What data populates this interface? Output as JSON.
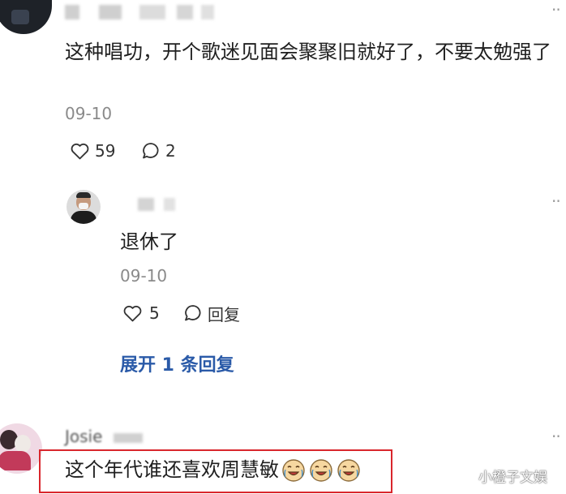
{
  "comment1": {
    "text": "这种唱功，开个歌迷见面会聚聚旧就好了，不要太勉强了",
    "date": "09-10",
    "likes": "59",
    "replies": "2"
  },
  "reply1": {
    "text": "退休了",
    "date": "09-10",
    "likes": "5",
    "reply_label": "回复"
  },
  "expand_label": "展开 1 条回复",
  "comment2": {
    "username": "Josie",
    "text": "这个年代谁还喜欢周慧敏",
    "emojis": [
      "crying-laugh-icon",
      "crying-laugh-icon",
      "crying-laugh-icon"
    ]
  },
  "more_label": "··",
  "watermark": "小橙子文娱",
  "colors": {
    "highlight": "#d9262c",
    "link": "#2a5aa8"
  }
}
